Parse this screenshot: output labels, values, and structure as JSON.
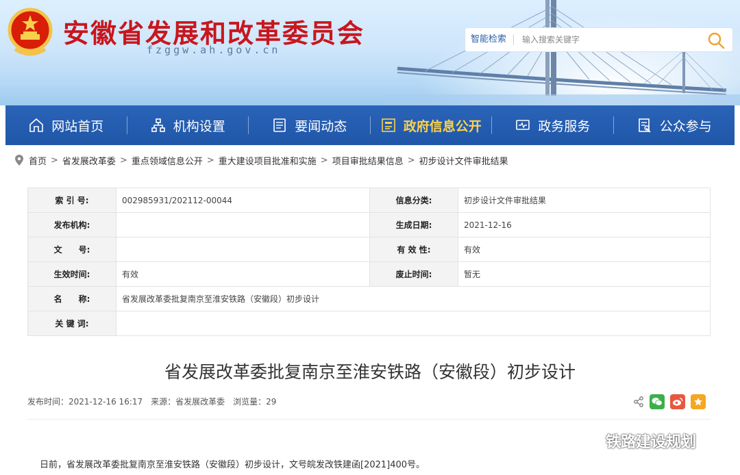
{
  "header": {
    "site_title": "安徽省发展和改革委员会",
    "site_domain": "fzggw.ah.gov.cn"
  },
  "search": {
    "label": "智能检索",
    "placeholder": "输入搜索关键字"
  },
  "nav": {
    "items": [
      {
        "label": "网站首页",
        "icon": "home-icon"
      },
      {
        "label": "机构设置",
        "icon": "org-chart-icon"
      },
      {
        "label": "要闻动态",
        "icon": "news-icon"
      },
      {
        "label": "政府信息公开",
        "icon": "info-disclosure-icon",
        "active": true
      },
      {
        "label": "政务服务",
        "icon": "service-icon"
      },
      {
        "label": "公众参与",
        "icon": "participation-icon"
      }
    ],
    "active_color": "#ffd24a"
  },
  "breadcrumb": {
    "items": [
      "首页",
      "省发展改革委",
      "重点领域信息公开",
      "重大建设项目批准和实施",
      "项目审批结果信息",
      "初步设计文件审批结果"
    ],
    "separator": ">"
  },
  "info_table": {
    "index_label": "索 引 号:",
    "index_value": "002985931/202112-00044",
    "category_label": "信息分类:",
    "category_value": "初步设计文件审批结果",
    "publisher_label": "发布机构:",
    "publisher_value": "",
    "generated_label": "生成日期:",
    "generated_value": "2021-12-16",
    "docno_label": "文　　号:",
    "docno_value": "",
    "validity_label": "有 效 性:",
    "validity_value": "有效",
    "effective_label": "生效时间:",
    "effective_value": "有效",
    "expiry_label": "废止时间:",
    "expiry_value": "暂无",
    "name_label": "名　　称:",
    "name_value": "省发展改革委批复南京至淮安铁路（安徽段）初步设计",
    "keywords_label": "关 键 词:",
    "keywords_value": ""
  },
  "article": {
    "title": "省发展改革委批复南京至淮安铁路（安徽段）初步设计",
    "publish_time": "发布时间：2021-12-16 16:17",
    "source": "来源：省发展改革委",
    "views": "浏览量：29",
    "body_first_line": "日前，省发展改革委批复南京至淮安铁路（安徽段）初步设计，文号皖发改铁建函[2021]400号。"
  },
  "watermark": {
    "text": "铁路建设规划"
  },
  "colors": {
    "title_red": "#c8161d",
    "nav_blue": "#1f56a8",
    "wechat_green": "#3bb04a",
    "weibo_orange": "#e8573e",
    "fav_yellow": "#f5a623"
  }
}
